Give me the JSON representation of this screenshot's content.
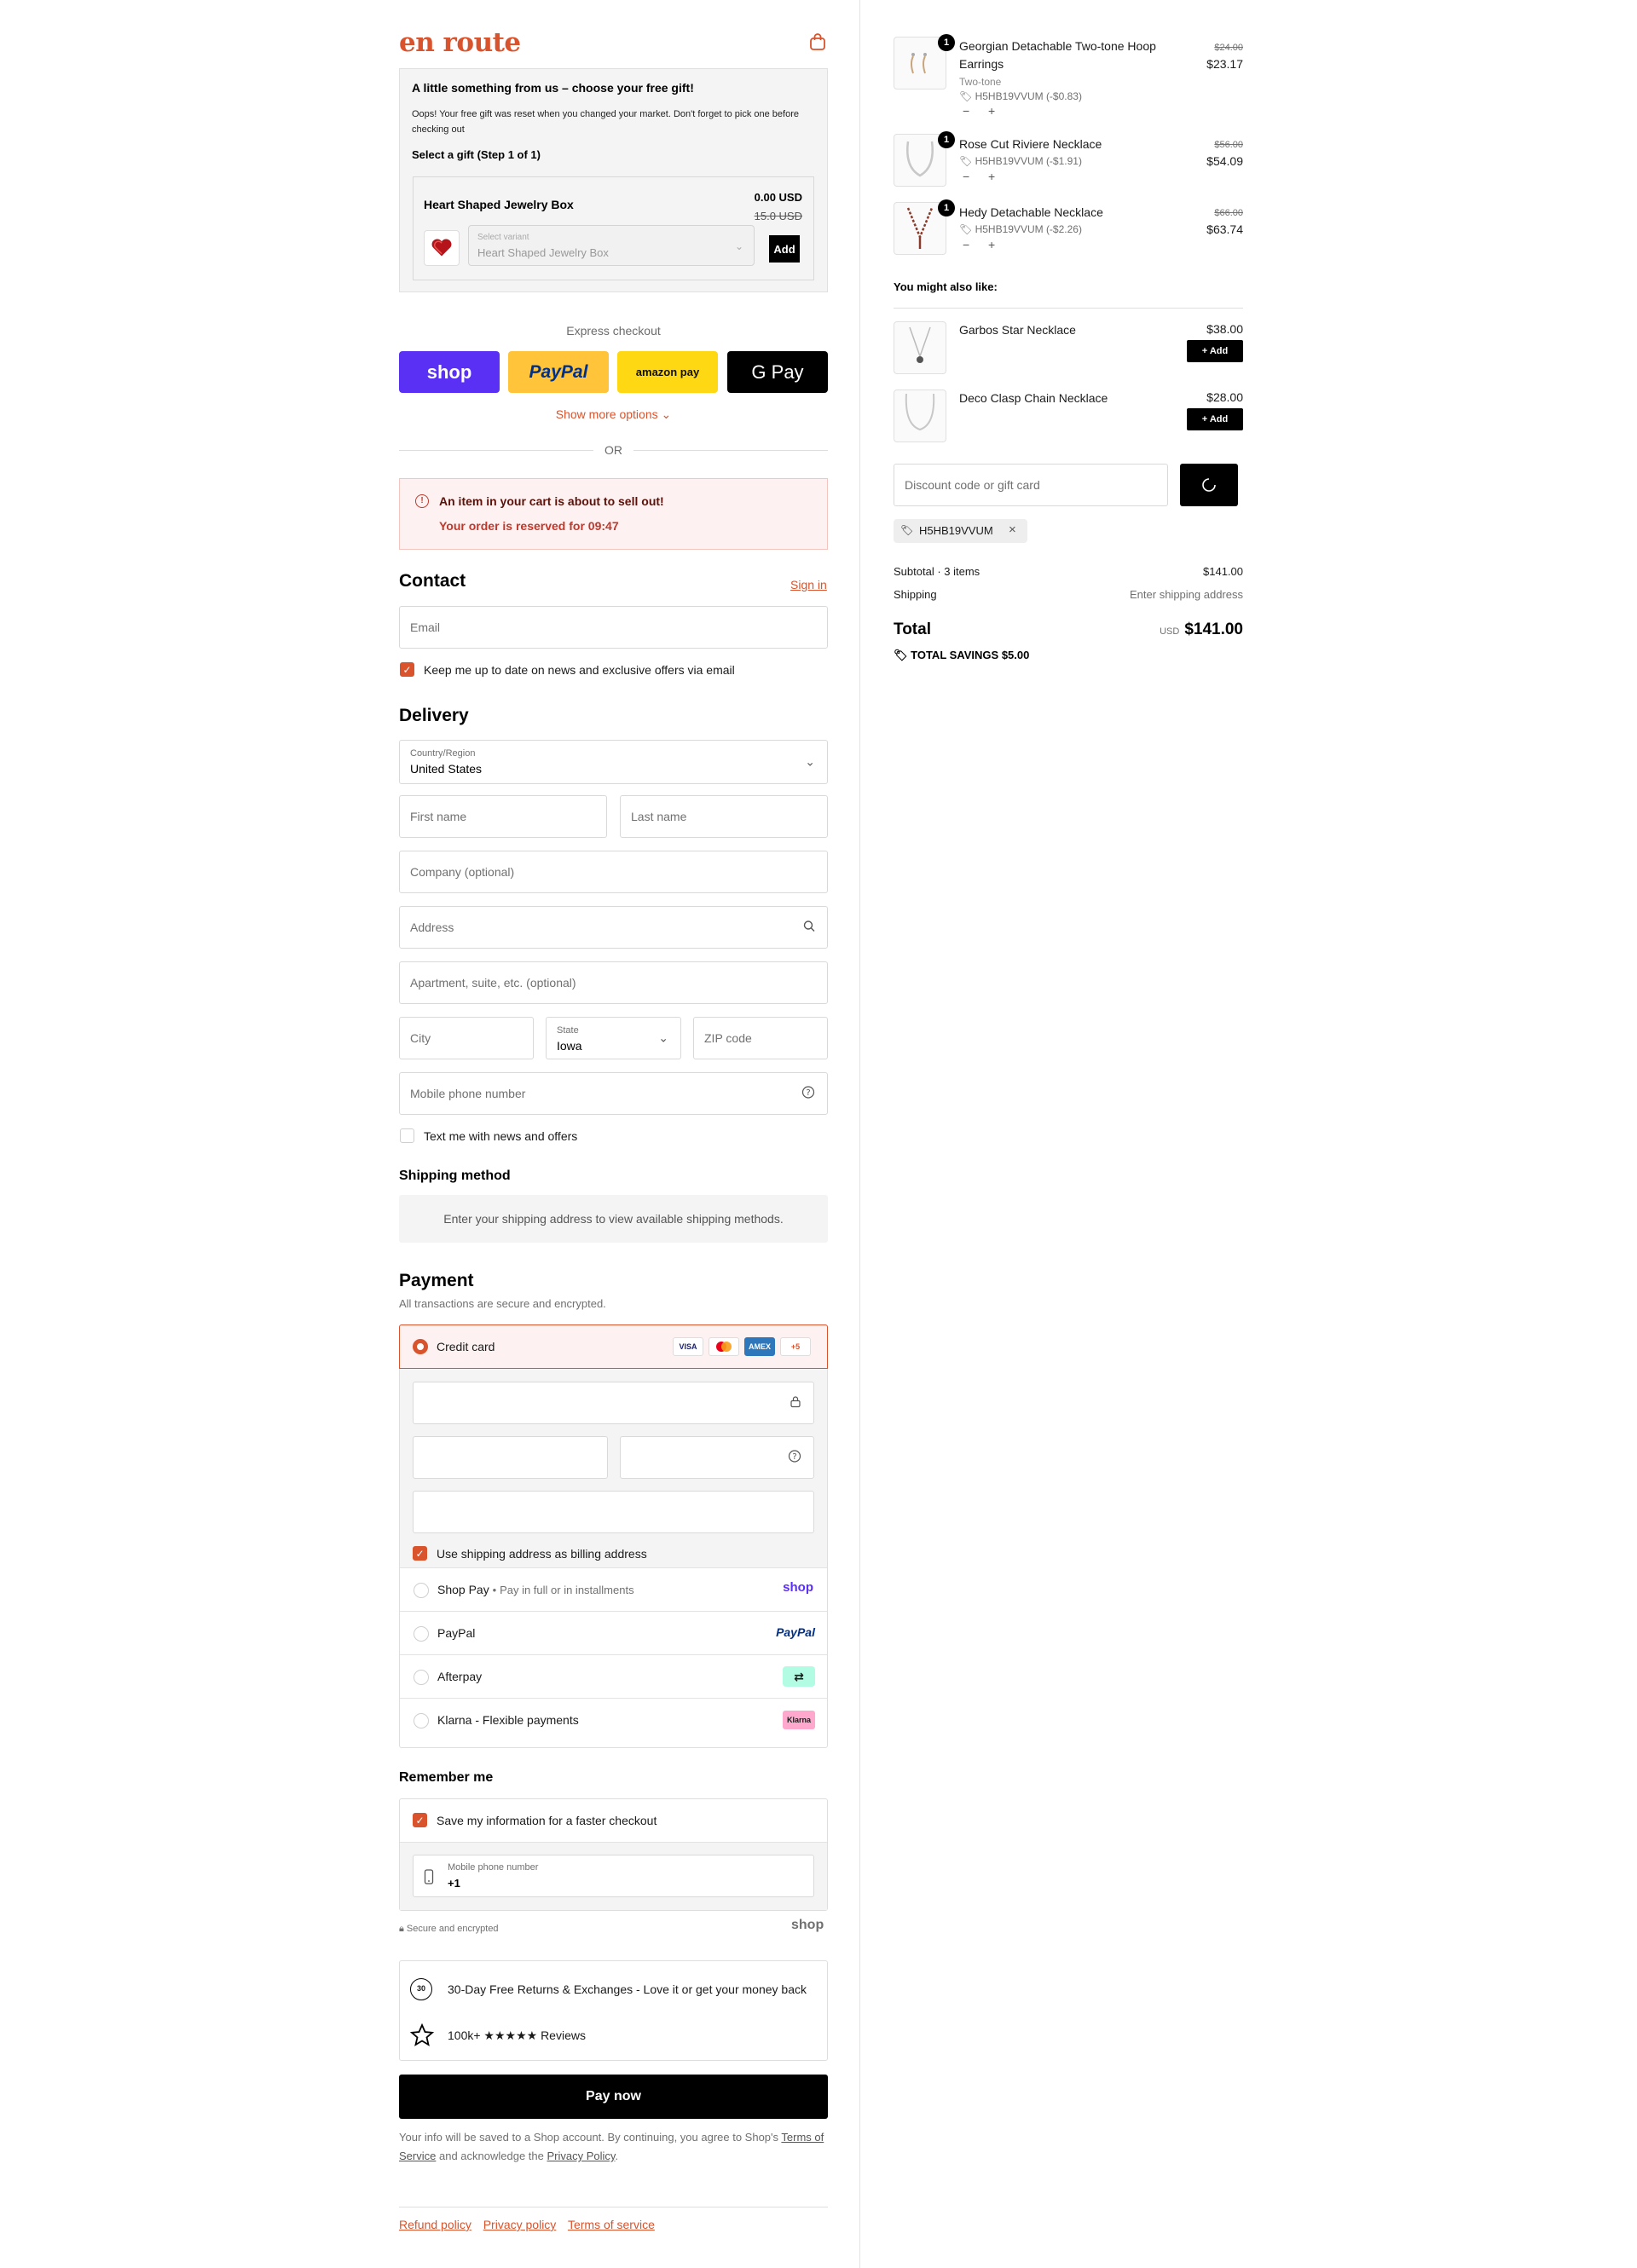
{
  "brand": {
    "logo": "en route",
    "accent": "#d9532c"
  },
  "gift": {
    "title": "A little something from us – choose your free gift!",
    "note": "Oops! Your free gift was reset when you changed your market. Don't forget to pick one before checking out",
    "step": "Select a gift (Step 1 of 1)",
    "item_name": "Heart Shaped Jewelry Box",
    "price": "0.00 USD",
    "old_price": "15.0 USD",
    "select_label": "Select variant",
    "select_value": "Heart Shaped Jewelry Box",
    "add_label": "Add"
  },
  "express": {
    "label": "Express checkout",
    "shop": "shop",
    "paypal": "PayPal",
    "amazon": "amazon pay",
    "gpay": "G Pay",
    "show_more": "Show more options",
    "or": "OR"
  },
  "alert": {
    "title": "An item in your cart is about to sell out!",
    "reserved": "Your order is reserved for 09:47"
  },
  "contact": {
    "heading": "Contact",
    "sign_in": "Sign in",
    "email_placeholder": "Email",
    "newsletter": "Keep me up to date on news and exclusive offers via email"
  },
  "delivery": {
    "heading": "Delivery",
    "country_label": "Country/Region",
    "country": "United States",
    "first_name": "First name",
    "last_name": "Last name",
    "company": "Company (optional)",
    "address": "Address",
    "apartment": "Apartment, suite, etc. (optional)",
    "city": "City",
    "state_label": "State",
    "state": "Iowa",
    "zip": "ZIP code",
    "phone": "Mobile phone number",
    "text_me": "Text me with news and offers"
  },
  "shipping": {
    "heading": "Shipping method",
    "note": "Enter your shipping address to view available shipping methods."
  },
  "payment": {
    "heading": "Payment",
    "sub": "All transactions are secure and encrypted.",
    "credit_card": "Credit card",
    "cards": [
      "VISA",
      "MC",
      "AMEX",
      "+5"
    ],
    "billing_same": "Use shipping address as billing address",
    "shop_pay": "Shop Pay",
    "shop_pay_sub": "Pay in full or in installments",
    "shop_pay_logo": "shop",
    "paypal": "PayPal",
    "paypal_logo": "PayPal",
    "afterpay": "Afterpay",
    "klarna": "Klarna - Flexible payments",
    "klarna_logo": "Klarna"
  },
  "remember": {
    "heading": "Remember me",
    "save": "Save my information for a faster checkout",
    "phone_label": "Mobile phone number",
    "phone_value": "+1",
    "secure": "Secure and encrypted",
    "shop_logo": "shop"
  },
  "trust": {
    "returns": "30-Day Free Returns & Exchanges - Love it or get your money back",
    "reviews": "100k+ ★★★★★ Reviews",
    "badge": "30"
  },
  "pay_now": "Pay now",
  "legal": {
    "text1": "Your info will be saved to a Shop account. By continuing, you agree to Shop's",
    "tos": "Terms of Service",
    "text2": "and acknowledge the",
    "privacy": "Privacy Policy",
    "end": "."
  },
  "footer": {
    "refund": "Refund policy",
    "privacy": "Privacy policy",
    "terms": "Terms of service"
  },
  "cart": {
    "items": [
      {
        "name": "Georgian Detachable Two-tone Hoop Earrings",
        "variant": "Two-tone",
        "discount": "H5HB19VVUM (-$0.83)",
        "old": "$24.00",
        "price": "$23.17",
        "qty": "1"
      },
      {
        "name": "Rose Cut Riviere Necklace",
        "variant": "",
        "discount": "H5HB19VVUM (-$1.91)",
        "old": "$56.00",
        "price": "$54.09",
        "qty": "1"
      },
      {
        "name": "Hedy Detachable Necklace",
        "variant": "",
        "discount": "H5HB19VVUM (-$2.26)",
        "old": "$66.00",
        "price": "$63.74",
        "qty": "1"
      }
    ],
    "upsell_heading": "You might also like:",
    "upsell": [
      {
        "name": "Garbos Star Necklace",
        "price": "$38.00",
        "add": "+ Add"
      },
      {
        "name": "Deco Clasp Chain Necklace",
        "price": "$28.00",
        "add": "+ Add"
      }
    ],
    "discount_placeholder": "Discount code or gift card",
    "applied_code": "H5HB19VVUM",
    "subtotal_label": "Subtotal · 3 items",
    "subtotal": "$141.00",
    "shipping_label": "Shipping",
    "shipping_value": "Enter shipping address",
    "total_label": "Total",
    "currency": "USD",
    "total": "$141.00",
    "savings_label": "TOTAL SAVINGS",
    "savings": "$5.00"
  }
}
